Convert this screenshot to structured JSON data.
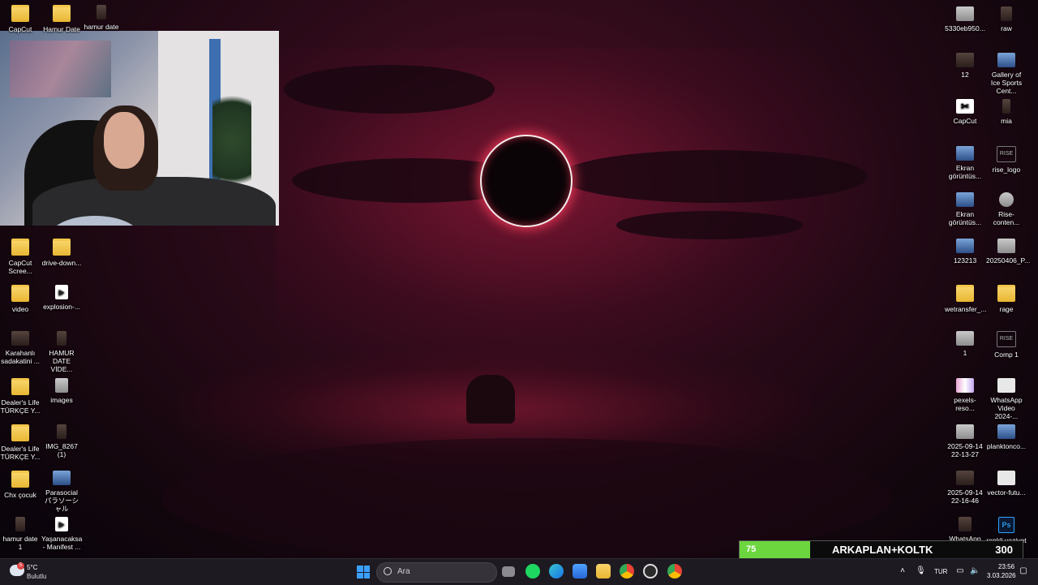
{
  "desktop_left": [
    {
      "label": "CapCut",
      "kind": "folder"
    },
    {
      "label": "Hamur Date",
      "kind": "folder"
    },
    {
      "label": "hamur date",
      "kind": "thumb-dark"
    },
    {
      "label": "CapCut Scree...",
      "kind": "folder"
    },
    {
      "label": "drive-down...",
      "kind": "folder"
    },
    {
      "label": "video",
      "kind": "folder"
    },
    {
      "label": "explosion-...",
      "kind": "thumb-video"
    },
    {
      "label": "Karahanlı sadakatini ...",
      "kind": "thumb-dark"
    },
    {
      "label": "HAMUR DATE VİDE...",
      "kind": "thumb-dark"
    },
    {
      "label": "Dealer's Life TÜRKÇE Y...",
      "kind": "folder"
    },
    {
      "label": "images",
      "kind": "thumb-grey"
    },
    {
      "label": "Dealer's Life TÜRKÇE Y...",
      "kind": "folder"
    },
    {
      "label": "IMG_8267 (1)",
      "kind": "thumb-dark"
    },
    {
      "label": "Chx çocuk",
      "kind": "folder"
    },
    {
      "label": "Parasocial パラソーシャル",
      "kind": "thumb-blue"
    },
    {
      "label": "hamur date 1",
      "kind": "thumb-dark"
    },
    {
      "label": "Yaşanacaksa - Manifest ...",
      "kind": "thumb-video"
    }
  ],
  "desktop_right": [
    {
      "label": "5330eb950...",
      "kind": "thumb-grey"
    },
    {
      "label": "raw",
      "kind": "thumb-dark"
    },
    {
      "label": "12",
      "kind": "thumb-dark"
    },
    {
      "label": "Gallery of Ice Sports Cent...",
      "kind": "thumb-blue"
    },
    {
      "label": "CapCut",
      "kind": "thumb-capcut"
    },
    {
      "label": "mia",
      "kind": "thumb-dark"
    },
    {
      "label": "Ekran görüntüs...",
      "kind": "thumb-blue"
    },
    {
      "label": "rise_logo",
      "kind": "thumb-logo"
    },
    {
      "label": "Ekran görüntüs...",
      "kind": "thumb-blue"
    },
    {
      "label": "Rise-conten...",
      "kind": "thumb-grey"
    },
    {
      "label": "123213",
      "kind": "thumb-blue"
    },
    {
      "label": "20250406_P...",
      "kind": "thumb-grey"
    },
    {
      "label": "wetransfer_...",
      "kind": "folder"
    },
    {
      "label": "rage",
      "kind": "folder"
    },
    {
      "label": "1",
      "kind": "thumb-grey"
    },
    {
      "label": "Comp 1",
      "kind": "thumb-logo"
    },
    {
      "label": "pexels-reso...",
      "kind": "thumb-pink"
    },
    {
      "label": "WhatsApp Video 2024-...",
      "kind": "thumb-white"
    },
    {
      "label": "2025-09-14 22-13-27",
      "kind": "thumb-grey"
    },
    {
      "label": "planktonco...",
      "kind": "thumb-blue"
    },
    {
      "label": "2025-09-14 22-16-46",
      "kind": "thumb-dark"
    },
    {
      "label": "vector-futu...",
      "kind": "thumb-white"
    },
    {
      "label": "WhatsApp Görsel 2025...",
      "kind": "thumb-dark"
    },
    {
      "label": "renkli vaziyet",
      "kind": "thumb-ps"
    }
  ],
  "icon_glyphs": {
    "CapCut": "✂",
    "ps": "Ps",
    "rise": "RISE"
  },
  "overlay": {
    "progress_value": "75",
    "progress_fraction": 0.25,
    "label": "ARKAPLAN+KOLTK",
    "goal": "300",
    "bar_color": "#6cd63f"
  },
  "taskbar": {
    "weather_temp": "5°C",
    "weather_desc": "Bulutlu",
    "weather_badge": "5",
    "search_placeholder": "Ara",
    "language": "TUR",
    "time": "23:56",
    "date": "3.03.2026",
    "apps": [
      "task-view",
      "spotify",
      "edge",
      "store",
      "file-explorer",
      "chrome",
      "obs",
      "chrome-profile"
    ]
  },
  "colors": {
    "accent": "#3aa0ff",
    "spotify": "#1ed760"
  }
}
